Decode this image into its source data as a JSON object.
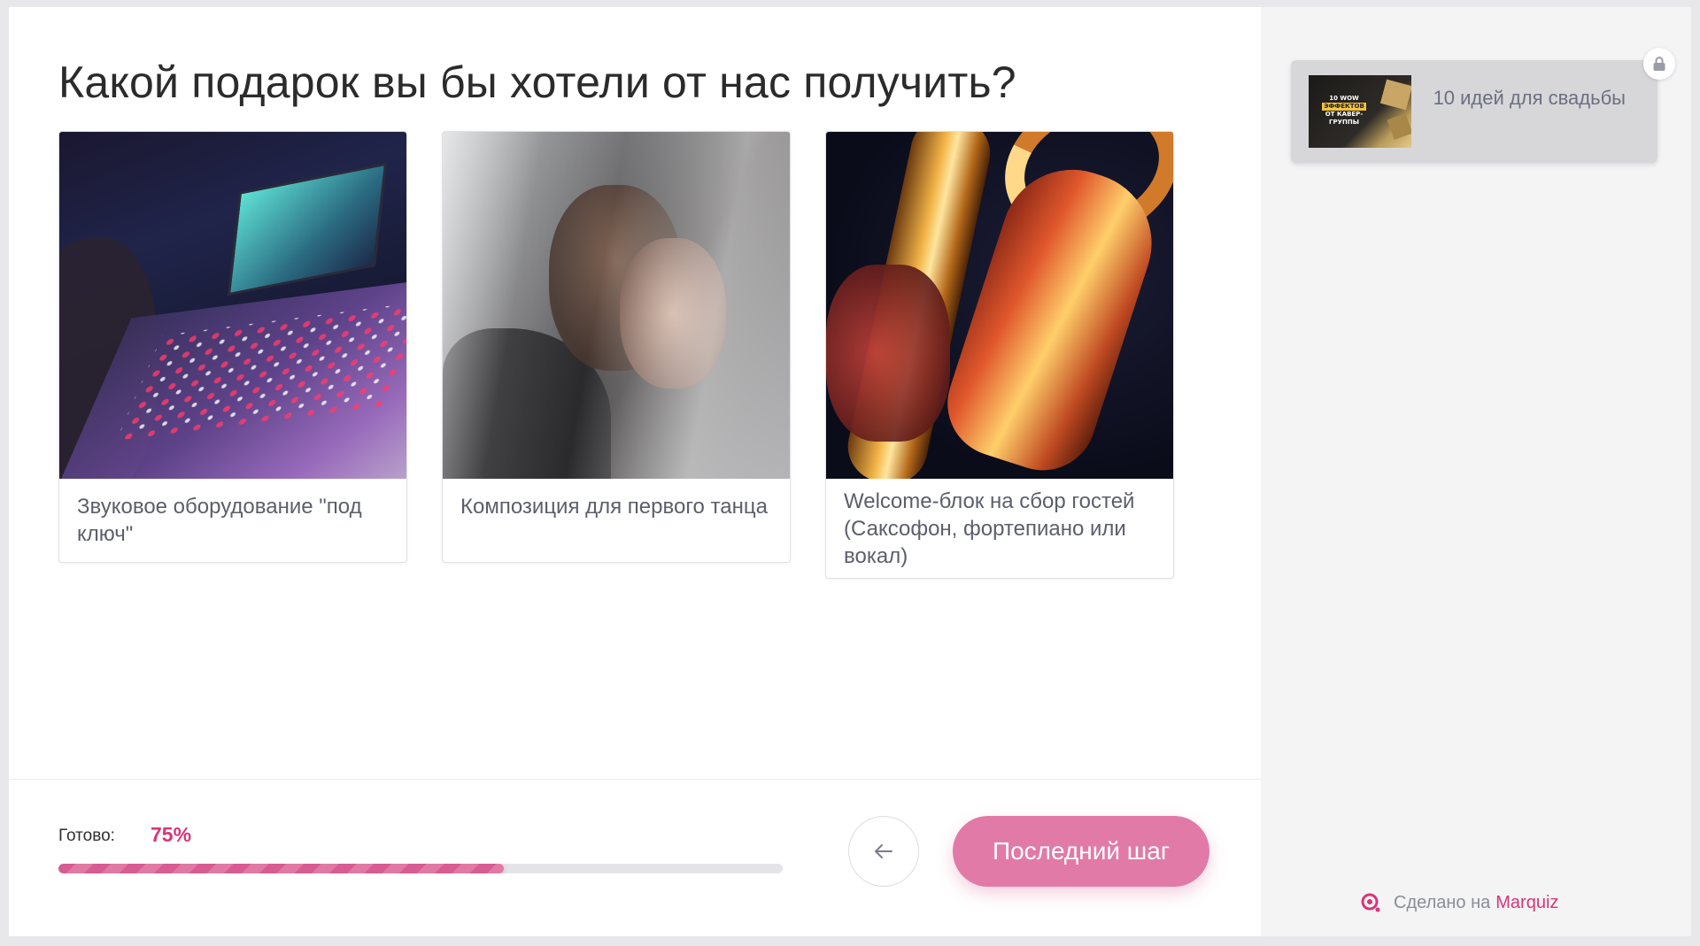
{
  "quiz": {
    "question": "Какой подарок вы бы хотели от нас получить?",
    "options": [
      {
        "label": "Звуковое оборудование \"под ключ\"",
        "image": "mixing-console-photo"
      },
      {
        "label": "Композиция для первого танца",
        "image": "wedding-couple-photo"
      },
      {
        "label": "Welcome-блок на сбор гостей (Саксофон, фортепиано или вокал)",
        "image": "saxophone-photo"
      }
    ]
  },
  "progress": {
    "label": "Готово:",
    "value_text": "75%",
    "fraction": 0.75
  },
  "navigation": {
    "back_icon": "arrow-left-icon",
    "next_label": "Последний шаг"
  },
  "sidebar": {
    "bonus": {
      "title": "10 идей для свадьбы",
      "thumb_text_1": "10 WOW",
      "thumb_text_2": "ЭФФЕКТОВ",
      "thumb_text_3": "ОТ КАВЕР-ГРУППЫ",
      "locked_icon": "lock-icon"
    },
    "brand": {
      "prefix": "Сделано на",
      "name": "Marquiz"
    }
  },
  "colors": {
    "accent": "#d8357a",
    "button": "#e17aa7",
    "sidebar_bg": "#f4f4f5"
  }
}
